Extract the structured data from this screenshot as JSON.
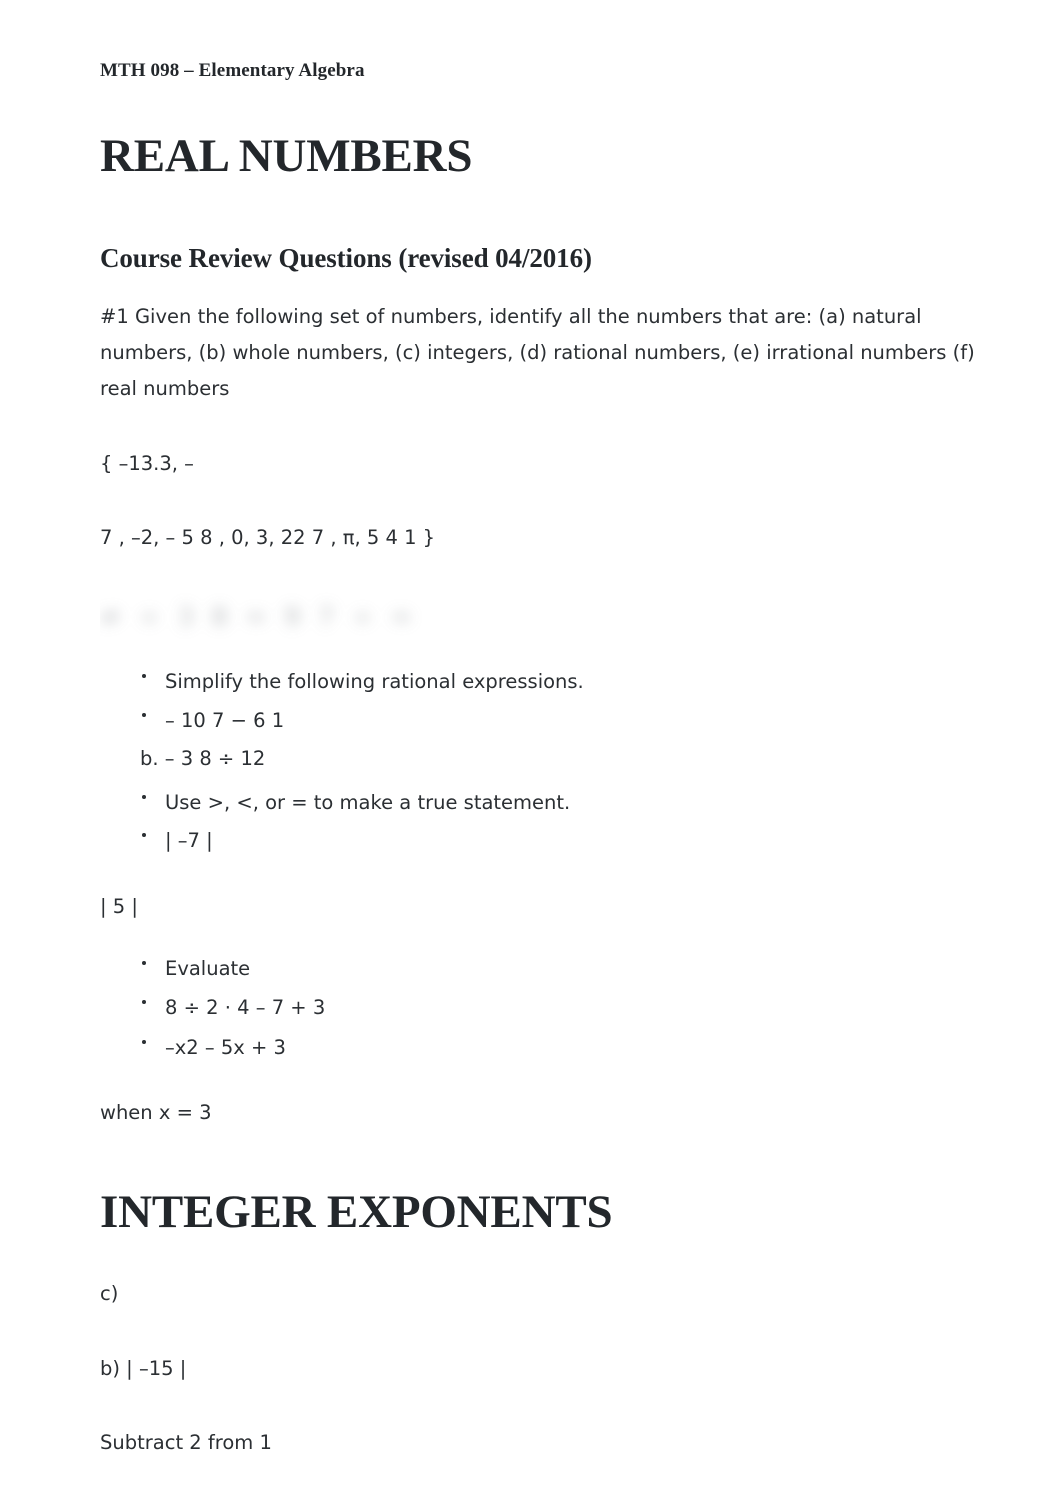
{
  "document": {
    "running_header": "MTH 098 – Elementary Algebra",
    "section_1_title": "REAL NUMBERS",
    "subheading": "Course Review Questions (revised 04/2016)",
    "question_1": "#1 Given the following set of numbers, identify all the numbers that are: (a) natural numbers, (b) whole numbers, (c) integers, (d) rational numbers, (e) irrational numbers (f) real numbers",
    "set_line_1": "{ –13.3, –",
    "set_line_2": "7 , –2, – 5 8 , 0, 3, 22 7 , π, 5 4 1 }",
    "blurred_expression": "≠ ÷ 3 8 ≈ 9 7 ÷ ≈",
    "list_1": [
      "Simplify the following rational expressions.",
      "– 10 7 − 6 1"
    ],
    "sub_item_b": "b. – 3 8 ÷ 12",
    "list_2": [
      "Use >, <, or = to make a true statement.",
      "| –7 |"
    ],
    "absolute_value_5": "| 5 |",
    "list_3": [
      "Evaluate",
      "8 ÷ 2 · 4 – 7 + 3",
      "–x2 – 5x + 3"
    ],
    "when_clause": "when x = 3",
    "section_2_title": "INTEGER EXPONENTS",
    "item_c": "c)",
    "item_b": "b) | –15 |",
    "instruction_subtract": "Subtract 2 from 1"
  }
}
